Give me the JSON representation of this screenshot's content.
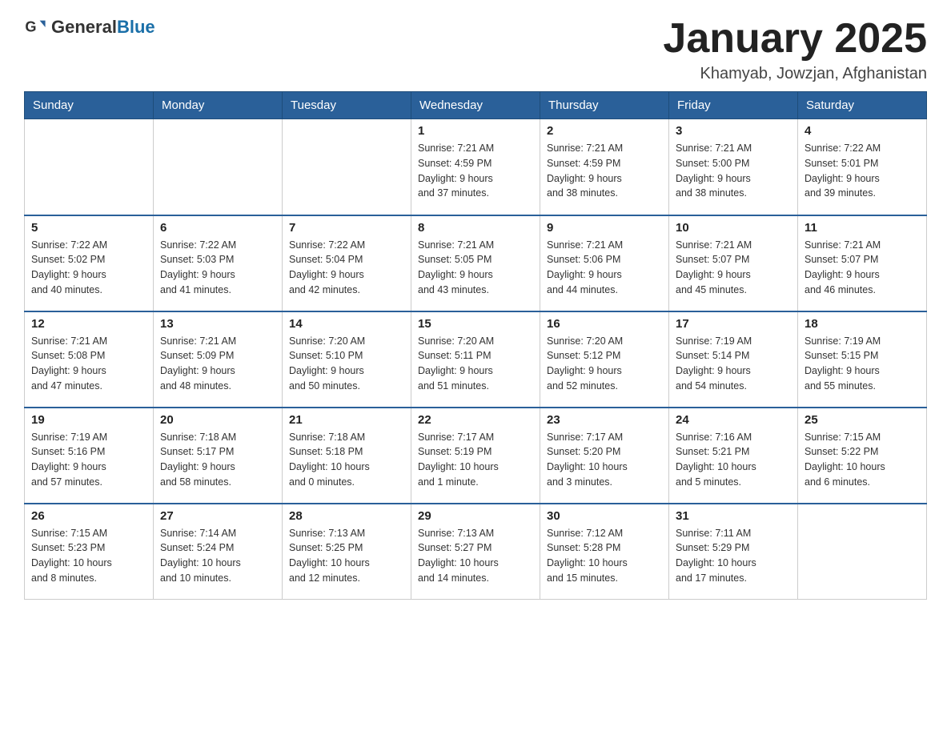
{
  "header": {
    "logo_general": "General",
    "logo_blue": "Blue",
    "title": "January 2025",
    "location": "Khamyab, Jowzjan, Afghanistan"
  },
  "weekdays": [
    "Sunday",
    "Monday",
    "Tuesday",
    "Wednesday",
    "Thursday",
    "Friday",
    "Saturday"
  ],
  "weeks": [
    [
      {
        "day": "",
        "info": ""
      },
      {
        "day": "",
        "info": ""
      },
      {
        "day": "",
        "info": ""
      },
      {
        "day": "1",
        "info": "Sunrise: 7:21 AM\nSunset: 4:59 PM\nDaylight: 9 hours\nand 37 minutes."
      },
      {
        "day": "2",
        "info": "Sunrise: 7:21 AM\nSunset: 4:59 PM\nDaylight: 9 hours\nand 38 minutes."
      },
      {
        "day": "3",
        "info": "Sunrise: 7:21 AM\nSunset: 5:00 PM\nDaylight: 9 hours\nand 38 minutes."
      },
      {
        "day": "4",
        "info": "Sunrise: 7:22 AM\nSunset: 5:01 PM\nDaylight: 9 hours\nand 39 minutes."
      }
    ],
    [
      {
        "day": "5",
        "info": "Sunrise: 7:22 AM\nSunset: 5:02 PM\nDaylight: 9 hours\nand 40 minutes."
      },
      {
        "day": "6",
        "info": "Sunrise: 7:22 AM\nSunset: 5:03 PM\nDaylight: 9 hours\nand 41 minutes."
      },
      {
        "day": "7",
        "info": "Sunrise: 7:22 AM\nSunset: 5:04 PM\nDaylight: 9 hours\nand 42 minutes."
      },
      {
        "day": "8",
        "info": "Sunrise: 7:21 AM\nSunset: 5:05 PM\nDaylight: 9 hours\nand 43 minutes."
      },
      {
        "day": "9",
        "info": "Sunrise: 7:21 AM\nSunset: 5:06 PM\nDaylight: 9 hours\nand 44 minutes."
      },
      {
        "day": "10",
        "info": "Sunrise: 7:21 AM\nSunset: 5:07 PM\nDaylight: 9 hours\nand 45 minutes."
      },
      {
        "day": "11",
        "info": "Sunrise: 7:21 AM\nSunset: 5:07 PM\nDaylight: 9 hours\nand 46 minutes."
      }
    ],
    [
      {
        "day": "12",
        "info": "Sunrise: 7:21 AM\nSunset: 5:08 PM\nDaylight: 9 hours\nand 47 minutes."
      },
      {
        "day": "13",
        "info": "Sunrise: 7:21 AM\nSunset: 5:09 PM\nDaylight: 9 hours\nand 48 minutes."
      },
      {
        "day": "14",
        "info": "Sunrise: 7:20 AM\nSunset: 5:10 PM\nDaylight: 9 hours\nand 50 minutes."
      },
      {
        "day": "15",
        "info": "Sunrise: 7:20 AM\nSunset: 5:11 PM\nDaylight: 9 hours\nand 51 minutes."
      },
      {
        "day": "16",
        "info": "Sunrise: 7:20 AM\nSunset: 5:12 PM\nDaylight: 9 hours\nand 52 minutes."
      },
      {
        "day": "17",
        "info": "Sunrise: 7:19 AM\nSunset: 5:14 PM\nDaylight: 9 hours\nand 54 minutes."
      },
      {
        "day": "18",
        "info": "Sunrise: 7:19 AM\nSunset: 5:15 PM\nDaylight: 9 hours\nand 55 minutes."
      }
    ],
    [
      {
        "day": "19",
        "info": "Sunrise: 7:19 AM\nSunset: 5:16 PM\nDaylight: 9 hours\nand 57 minutes."
      },
      {
        "day": "20",
        "info": "Sunrise: 7:18 AM\nSunset: 5:17 PM\nDaylight: 9 hours\nand 58 minutes."
      },
      {
        "day": "21",
        "info": "Sunrise: 7:18 AM\nSunset: 5:18 PM\nDaylight: 10 hours\nand 0 minutes."
      },
      {
        "day": "22",
        "info": "Sunrise: 7:17 AM\nSunset: 5:19 PM\nDaylight: 10 hours\nand 1 minute."
      },
      {
        "day": "23",
        "info": "Sunrise: 7:17 AM\nSunset: 5:20 PM\nDaylight: 10 hours\nand 3 minutes."
      },
      {
        "day": "24",
        "info": "Sunrise: 7:16 AM\nSunset: 5:21 PM\nDaylight: 10 hours\nand 5 minutes."
      },
      {
        "day": "25",
        "info": "Sunrise: 7:15 AM\nSunset: 5:22 PM\nDaylight: 10 hours\nand 6 minutes."
      }
    ],
    [
      {
        "day": "26",
        "info": "Sunrise: 7:15 AM\nSunset: 5:23 PM\nDaylight: 10 hours\nand 8 minutes."
      },
      {
        "day": "27",
        "info": "Sunrise: 7:14 AM\nSunset: 5:24 PM\nDaylight: 10 hours\nand 10 minutes."
      },
      {
        "day": "28",
        "info": "Sunrise: 7:13 AM\nSunset: 5:25 PM\nDaylight: 10 hours\nand 12 minutes."
      },
      {
        "day": "29",
        "info": "Sunrise: 7:13 AM\nSunset: 5:27 PM\nDaylight: 10 hours\nand 14 minutes."
      },
      {
        "day": "30",
        "info": "Sunrise: 7:12 AM\nSunset: 5:28 PM\nDaylight: 10 hours\nand 15 minutes."
      },
      {
        "day": "31",
        "info": "Sunrise: 7:11 AM\nSunset: 5:29 PM\nDaylight: 10 hours\nand 17 minutes."
      },
      {
        "day": "",
        "info": ""
      }
    ]
  ]
}
